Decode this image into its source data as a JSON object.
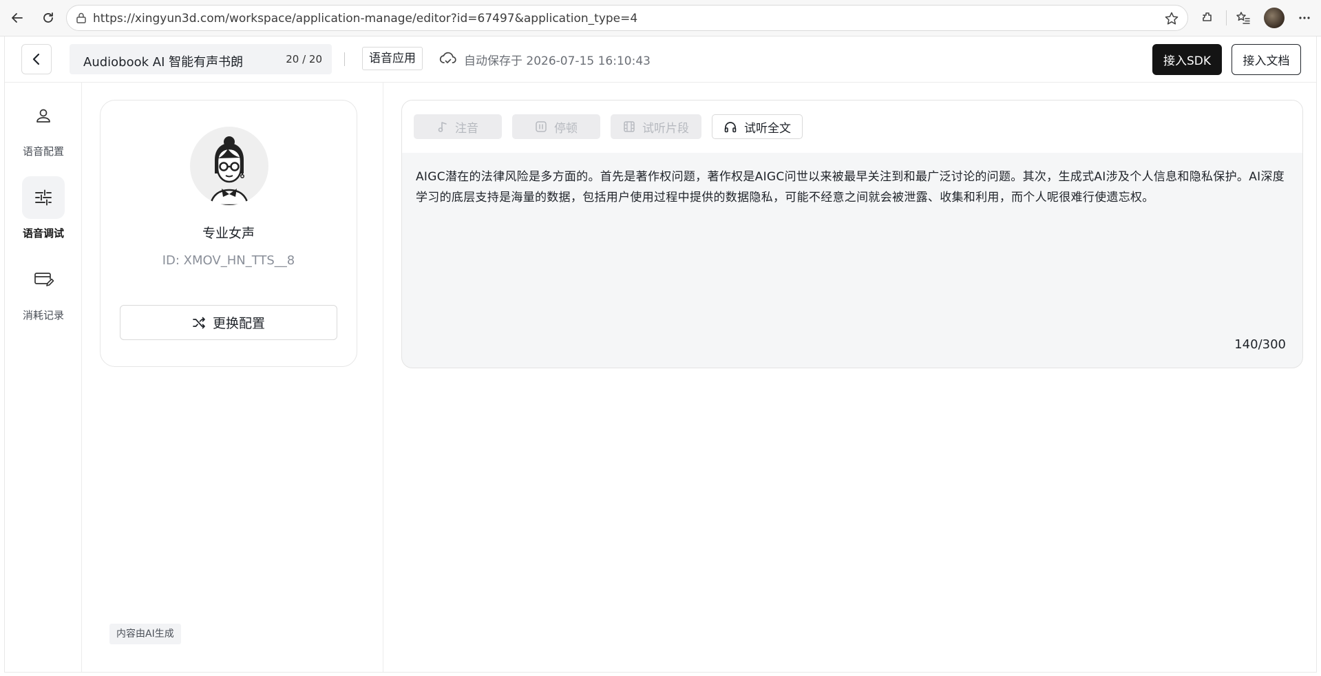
{
  "browser": {
    "url": "https://xingyun3d.com/workspace/application-manage/editor?id=67497&application_type=4"
  },
  "header": {
    "title": "Audiobook AI 智能有声书朗",
    "title_count": "20 / 20",
    "app_type": "语音应用",
    "autosave": "自动保存于 2026-07-15 16:10:43",
    "sdk_button": "接入SDK",
    "docs_button": "接入文档"
  },
  "nav": {
    "items": [
      {
        "label": "语音配置",
        "icon": "user-icon",
        "active": false
      },
      {
        "label": "语音调试",
        "icon": "sliders-icon",
        "active": true
      },
      {
        "label": "消耗记录",
        "icon": "card-edit-icon",
        "active": false
      }
    ]
  },
  "voice": {
    "name": "专业女声",
    "id": "ID: XMOV_HN_TTS__8",
    "change_button": "更换配置"
  },
  "footer_tag": "内容由AI生成",
  "editor": {
    "toolbar": {
      "phonetic": "注音",
      "pause": "停顿",
      "preview_segment": "试听片段",
      "preview_all": "试听全文"
    },
    "text": "AIGC潜在的法律风险是多方面的。首先是著作权问题，著作权是AIGC问世以来被最早关注到和最广泛讨论的问题。其次，生成式AI涉及个人信息和隐私保护。AI深度学习的底层支持是海量的数据，包括用户使用过程中提供的数据隐私，可能不经意之间就会被泄露、收集和利用，而个人呢很难行使遗忘权。",
    "char_count": "140/300"
  }
}
